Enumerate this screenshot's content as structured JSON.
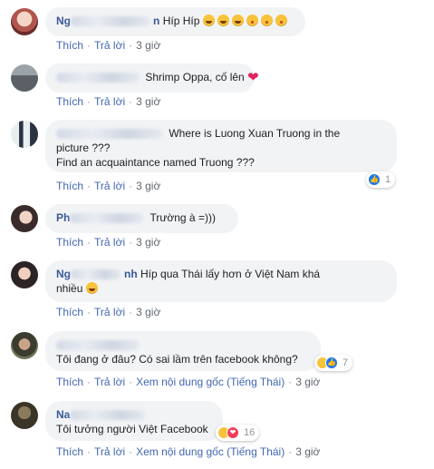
{
  "actions": {
    "like": "Thích",
    "reply": "Trả lời",
    "see_original": "Xem nội dung gốc (Tiếng Thái)",
    "separator": "·"
  },
  "comments": [
    {
      "name_visible": "Ng",
      "name_tail": "n",
      "text": "Híp Híp",
      "emojis": [
        "haha",
        "haha",
        "haha",
        "kiss",
        "kiss",
        "kiss"
      ],
      "time": "3 giờ"
    },
    {
      "name_visible": "",
      "text": "Shrimp Oppa, cố lên",
      "emojis": [
        "heart"
      ],
      "time": "3 giờ"
    },
    {
      "name_visible": "",
      "text_line1": "Where is Luong Xuan Truong in the",
      "text_line2": "picture ???",
      "text_line3": "Find an acquaintance named Truong ???",
      "reaction_count": "1",
      "time": "3 giờ"
    },
    {
      "name_visible": "Ph",
      "text": "Trường à =)))",
      "time": "3 giờ"
    },
    {
      "name_visible": "Ng",
      "name_tail": "nh",
      "text_line1": "Híp qua Thái lấy hơn ở Việt Nam khá",
      "text_line2": "nhiều",
      "emojis": [
        "haha"
      ],
      "time": "3 giờ"
    },
    {
      "name_visible": "",
      "text": "Tôi đang ở đâu? Có sai lầm trên facebook không?",
      "reaction_count": "7",
      "time": "3 giờ"
    },
    {
      "name_visible": "Na",
      "text": "Tôi tưởng người Việt Facebook",
      "reaction_count": "16",
      "time": "3 giờ"
    }
  ]
}
